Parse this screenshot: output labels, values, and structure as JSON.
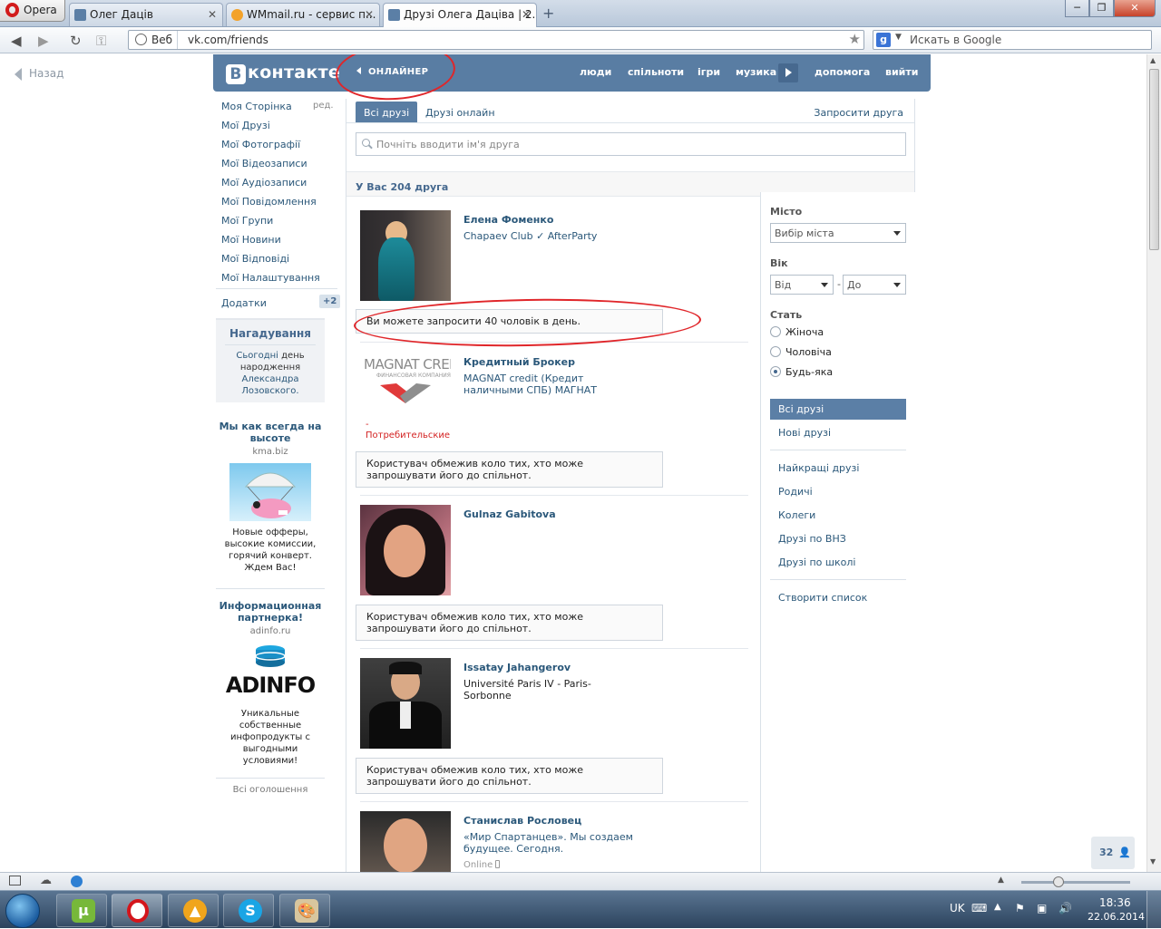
{
  "browser": {
    "menu_label": "Opera",
    "tabs": [
      {
        "label": "Олег Даців",
        "active": false
      },
      {
        "label": "WMmail.ru - сервис п...",
        "active": false
      },
      {
        "label": "Друзі Олега Даціва | 2...",
        "active": true
      }
    ],
    "site_label": "Веб",
    "url": "vk.com/friends",
    "search_placeholder": "Искать в Google",
    "back_label": "Назад"
  },
  "vk": {
    "logo": "контакте",
    "logo_mark": "В",
    "online_label": "ОНЛАЙНЕР",
    "nav": [
      "люди",
      "спільноти",
      "ігри",
      "музика",
      "допомога",
      "вийти"
    ],
    "sidebar": {
      "edit": "ред.",
      "items": [
        "Моя Сторінка",
        "Мої Друзі",
        "Мої Фотографії",
        "Мої Відеозаписи",
        "Мої Аудіозаписи",
        "Мої Повідомлення",
        "Мої Групи",
        "Мої Новини",
        "Мої Відповіді",
        "Мої Налаштування"
      ],
      "apps": "Додатки",
      "apps_count": "+2"
    },
    "reminder": {
      "title": "Нагадування",
      "today": "Сьогодні",
      "text": "день народження",
      "name": "Александра Лозовского."
    },
    "ads": [
      {
        "title": "Мы как всегда на высоте",
        "domain": "kma.biz",
        "body": "Новые офферы, высокие комиссии, горячий конверт. Ждем Вас!"
      },
      {
        "title": "Информационная партнерка!",
        "domain": "adinfo.ru",
        "logo": "ADINFO",
        "body": "Уникальные собственные инфопродукты с выгодными условиями!"
      }
    ],
    "all_ads": "Всі оголошення",
    "tabs": {
      "all": "Всі друзі",
      "online": "Друзі онлайн",
      "invite": "Запросити друга"
    },
    "search_placeholder": "Почніть вводити ім'я друга",
    "count_text": "У Вас 204 друга",
    "friends": [
      {
        "name": "Елена Фоменко",
        "info": "Chapaev Club ✓ AfterParty",
        "note": "Ви можете запросити 40 чоловік в день."
      },
      {
        "name": "Кредитный Брокер",
        "info": "MAGNAT credit (Кредит наличными СПБ) МАГНАТ",
        "photo_text": "MAGNAT CREDIT",
        "photo_sub": "ФИНАНСОВАЯ КОМПАНИЯ",
        "photo_caption": "- Потребительские кредиты",
        "note": "Користувач обмежив коло тих, хто може запрошувати його до спільнот."
      },
      {
        "name": "Gulnaz Gabitova",
        "info": "",
        "note": "Користувач обмежив коло тих, хто може запрошувати його до спільнот."
      },
      {
        "name": "Issatay Jahangerov",
        "info": "Université Paris IV - Paris-Sorbonne",
        "note": "Користувач обмежив коло тих, хто може запрошувати його до спільнот."
      },
      {
        "name": "Станислав Рословец",
        "info": "«Мир Спартанцев». Мы создаем будущее. Сегодня.",
        "status": "Online"
      }
    ],
    "filter": {
      "city_label": "Місто",
      "city_value": "Вибір міста",
      "age_label": "Вік",
      "age_from": "Від",
      "age_dash": "-",
      "age_to": "До",
      "sex_label": "Стать",
      "sex_options": [
        "Жіноча",
        "Чоловіча",
        "Будь-яка"
      ],
      "sex_selected": "Будь-яка",
      "lists_primary": [
        "Всі друзі",
        "Нові друзі"
      ],
      "lists_secondary": [
        "Найкращі друзі",
        "Родичі",
        "Колеги",
        "Друзі по ВНЗ",
        "Друзі по школі"
      ],
      "create_list": "Створити список"
    },
    "im_count": "32"
  },
  "os": {
    "language": "UK",
    "time": "18:36",
    "date": "22.06.2014"
  },
  "colors": {
    "vk_blue": "#597da3",
    "link": "#2b587a",
    "marker_red": "#e0262a"
  }
}
